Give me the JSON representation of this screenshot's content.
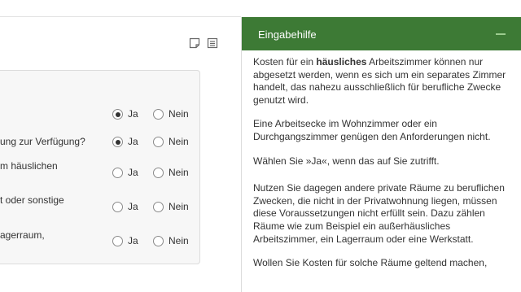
{
  "toolbar": {
    "icons": [
      "note-icon",
      "document-list-icon"
    ]
  },
  "questions": [
    {
      "text": "",
      "options": [
        "Ja",
        "Nein"
      ],
      "selected": "Ja"
    },
    {
      "text": "ung zur Verfügung?",
      "options": [
        "Ja",
        "Nein"
      ],
      "selected": "Ja"
    },
    {
      "text": "m häuslichen",
      "options": [
        "Ja",
        "Nein"
      ],
      "selected": ""
    },
    {
      "text": "t oder sonstige",
      "options": [
        "Ja",
        "Nein"
      ],
      "selected": ""
    },
    {
      "text": "agerraum,",
      "options": [
        "Ja",
        "Nein"
      ],
      "selected": ""
    }
  ],
  "help_panel": {
    "title": "Eingabehilfe",
    "p1_before": "Kosten für ein ",
    "p1_bold": "häusliches",
    "p1_after": " Arbeitszimmer können nur abgesetzt werden, wenn es sich um ein separates Zimmer handelt, das nahezu ausschließlich für berufliche Zwecke genutzt wird.",
    "p2": "Eine Arbeitsecke im Wohnzimmer oder ein Durchgangszimmer genügen den Anforderungen nicht.",
    "p3": "Wählen Sie »Ja«, wenn das auf Sie zutrifft.",
    "p4": "Nutzen Sie dagegen andere private Räume zu beruflichen Zwecken, die nicht in der Privatwohnung liegen, müssen diese Voraussetzungen nicht erfüllt sein. Dazu zählen Räume wie zum Beispiel ein außerhäusliches Arbeitszimmer, ein Lagerraum oder eine Werkstatt.",
    "p5": "Wollen Sie Kosten für solche Räume geltend machen,"
  },
  "colors": {
    "panel_header": "#3d7a35",
    "card_background": "#f7f7f7"
  }
}
